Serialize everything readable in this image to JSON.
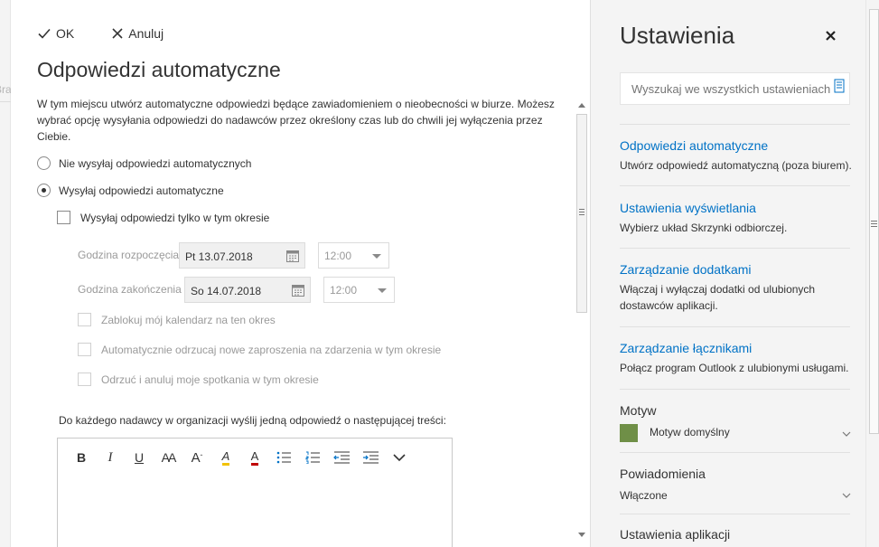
{
  "background": {
    "partial_text": "Bra"
  },
  "toolbar": {
    "ok_label": "OK",
    "cancel_label": "Anuluj"
  },
  "page": {
    "title": "Odpowiedzi automatyczne",
    "intro": "W tym miejscu utwórz automatyczne odpowiedzi będące zawiadomieniem o nieobecności w biurze. Możesz wybrać opcję wysyłania odpowiedzi do nadawców przez określony czas lub do chwili jej wyłączenia przez Ciebie."
  },
  "options": {
    "no_reply": "Nie wysyłaj odpowiedzi automatycznych",
    "send_reply": "Wysyłaj odpowiedzi automatyczne",
    "selected": "send_reply",
    "only_period": "Wysyłaj odpowiedzi tylko w tym okresie"
  },
  "schedule": {
    "start_label": "Godzina rozpoczęcia",
    "start_date": "Pt 13.07.2018",
    "start_time": "12:00",
    "end_label": "Godzina zakończenia",
    "end_date": "So 14.07.2018",
    "end_time": "12:00",
    "block_calendar": "Zablokuj mój kalendarz na ten okres",
    "decline_invites": "Automatycznie odrzucaj nowe zaproszenia na zdarzenia w tym okresie",
    "cancel_meetings": "Odrzuć i anuluj moje spotkania w tym okresie"
  },
  "reply": {
    "label": "Do każdego nadawcy w organizacji wyślij jedną odpowiedź o następującej treści:",
    "toolbar": [
      "bold-icon",
      "italic-icon",
      "underline-icon",
      "font-size-icon",
      "grow-font-icon",
      "highlight-icon",
      "font-color-icon",
      "bullets-icon",
      "numbering-icon",
      "decrease-indent-icon",
      "increase-indent-icon",
      "more-icon"
    ],
    "tool_glyphs": {
      "bold": "B",
      "italic": "I",
      "underline": "U",
      "font_size": "AA",
      "grow_font": "A",
      "highlight": "A",
      "font_color": "A"
    },
    "highlight_color": "#f2c200",
    "font_color": "#c00000"
  },
  "settings": {
    "title": "Ustawienia",
    "search_placeholder": "Wyszukaj we wszystkich ustawieniach",
    "items": [
      {
        "link": "Odpowiedzi automatyczne",
        "desc": "Utwórz odpowiedź automatyczną (poza biurem)."
      },
      {
        "link": "Ustawienia wyświetlania",
        "desc": "Wybierz układ Skrzynki odbiorczej."
      },
      {
        "link": "Zarządzanie dodatkami",
        "desc": "Włączaj i wyłączaj dodatki od ulubionych dostawców aplikacji."
      },
      {
        "link": "Zarządzanie łącznikami",
        "desc": "Połącz program Outlook z ulubionymi usługami."
      }
    ],
    "theme": {
      "heading": "Motyw",
      "value": "Motyw domyślny",
      "swatch_color": "#6f8f47"
    },
    "notifications": {
      "heading": "Powiadomienia",
      "value": "Włączone"
    },
    "app_settings": {
      "heading": "Ustawienia aplikacji"
    },
    "link_color": "#0072c6"
  }
}
